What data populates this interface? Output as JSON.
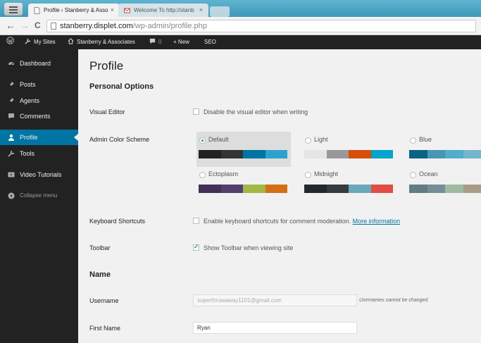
{
  "browser": {
    "tabs": [
      {
        "label": "Profile ‹ Stanberry & Asso",
        "close": "×"
      },
      {
        "label": "Welcome To http://stanb",
        "close": "×"
      }
    ],
    "nav": {
      "back": "←",
      "forward": "→",
      "reload": "C"
    },
    "url_host": "stanberry.displet.com",
    "url_path": "/wp-admin/profile.php"
  },
  "adminbar": {
    "my_sites": "My Sites",
    "site_name": "Stanberry & Associates",
    "comments_count": "0",
    "new": "+ New",
    "seo": "SEO"
  },
  "sidebar": {
    "items": [
      {
        "label": "Dashboard",
        "icon": "dashboard-icon"
      },
      {
        "label": "Posts",
        "icon": "pin-icon"
      },
      {
        "label": "Agents",
        "icon": "pin-icon"
      },
      {
        "label": "Comments",
        "icon": "comment-icon"
      },
      {
        "label": "Profile",
        "icon": "user-icon"
      },
      {
        "label": "Tools",
        "icon": "wrench-icon"
      },
      {
        "label": "Video Tutorials",
        "icon": "video-icon"
      },
      {
        "label": "Collapse menu",
        "icon": "collapse-icon"
      }
    ]
  },
  "main": {
    "title": "Profile",
    "personal_options": "Personal Options",
    "visual_editor": {
      "label": "Visual Editor",
      "option": "Disable the visual editor when writing",
      "checked": false
    },
    "color_scheme": {
      "label": "Admin Color Scheme",
      "selected": "Default",
      "schemes": [
        {
          "name": "Default",
          "colors": [
            "#222222",
            "#333333",
            "#0074a2",
            "#2ea2cc"
          ]
        },
        {
          "name": "Light",
          "colors": [
            "#e5e5e5",
            "#999999",
            "#d64e07",
            "#04a4cc"
          ]
        },
        {
          "name": "Blue",
          "colors": [
            "#096484",
            "#4796b3",
            "#52accc",
            "#74b6ce"
          ]
        },
        {
          "name": "Ectoplasm",
          "colors": [
            "#413256",
            "#523f6d",
            "#a3b745",
            "#d46f15"
          ]
        },
        {
          "name": "Midnight",
          "colors": [
            "#25282b",
            "#363b3f",
            "#69a8bb",
            "#e14d43"
          ]
        },
        {
          "name": "Ocean",
          "colors": [
            "#627c83",
            "#738e96",
            "#9ebaa0",
            "#aa9d88"
          ]
        }
      ]
    },
    "keyboard_shortcuts": {
      "label": "Keyboard Shortcuts",
      "option": "Enable keyboard shortcuts for comment moderation.",
      "link": "More information",
      "checked": false
    },
    "toolbar": {
      "label": "Toolbar",
      "option": "Show Toolbar when viewing site",
      "checked": true
    },
    "name_section": "Name",
    "username": {
      "label": "Username",
      "value": "superthrowaway1101@gmail.com",
      "note": "Usernames cannot be changed."
    },
    "first_name": {
      "label": "First Name",
      "value": "Ryan"
    }
  }
}
